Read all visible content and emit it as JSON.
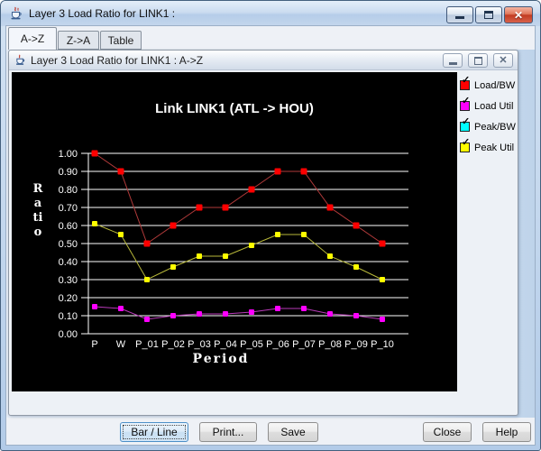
{
  "window": {
    "title": "Layer 3 Load Ratio for LINK1 :"
  },
  "tabs": [
    {
      "label": "A->Z",
      "selected": true
    },
    {
      "label": "Z->A",
      "selected": false
    },
    {
      "label": "Table",
      "selected": false
    }
  ],
  "inner_window": {
    "title": "Layer 3 Load Ratio for LINK1 : A->Z"
  },
  "chart_data": {
    "type": "line",
    "title": "Link LINK1 (ATL -> HOU)",
    "xlabel": "Period",
    "ylabel": "Ratio",
    "ylim": [
      0.0,
      1.0
    ],
    "ytick_step": 0.1,
    "ytick_labels": [
      "0.00",
      "0.10",
      "0.20",
      "0.30",
      "0.40",
      "0.50",
      "0.60",
      "0.70",
      "0.80",
      "0.90",
      "1.00"
    ],
    "categories": [
      "P",
      "W",
      "P_01",
      "P_02",
      "P_03",
      "P_04",
      "P_05",
      "P_06",
      "P_07",
      "P_08",
      "P_09",
      "P_10"
    ],
    "series": [
      {
        "name": "Load/BW",
        "color": "#ff0000",
        "line_color": "#b03a3a",
        "marker_size": 7,
        "values": [
          1.0,
          0.9,
          0.5,
          0.6,
          0.7,
          0.7,
          0.8,
          0.9,
          0.9,
          0.7,
          0.6,
          0.5
        ]
      },
      {
        "name": "Peak Util",
        "color": "#ffff00",
        "line_color": "#b8b83a",
        "marker_size": 6,
        "values": [
          0.61,
          0.55,
          0.3,
          0.37,
          0.43,
          0.43,
          0.49,
          0.55,
          0.55,
          0.43,
          0.37,
          0.3
        ]
      },
      {
        "name": "Load Util",
        "color": "#ff00ff",
        "line_color": "#b83ab8",
        "marker_size": 6,
        "values": [
          0.15,
          0.14,
          0.08,
          0.1,
          0.11,
          0.11,
          0.12,
          0.14,
          0.14,
          0.11,
          0.1,
          0.08
        ]
      }
    ],
    "legend": [
      {
        "label": "Load/BW",
        "color": "#ff0000"
      },
      {
        "label": "Load Util",
        "color": "#ff00ff"
      },
      {
        "label": "Peak/BW",
        "color": "#00ffff"
      },
      {
        "label": "Peak Util",
        "color": "#ffff00"
      }
    ],
    "legend_position": "right",
    "grid": true,
    "background": "#000000",
    "hidden_series_note": "Peak/BW line is not visible in the plot area (only in legend)"
  },
  "buttons": {
    "bar_line": "Bar / Line",
    "print": "Print...",
    "save": "Save",
    "close": "Close",
    "help": "Help"
  },
  "colors": {
    "titlebar_top": "#e4eef9",
    "titlebar_bottom": "#b6cde9",
    "content_bg": "#eef1f6",
    "desktop_bg": "#bed3ea",
    "chart_bg": "#000000",
    "grid_color": "#ffffff",
    "close_button_red": "#c13c22"
  }
}
